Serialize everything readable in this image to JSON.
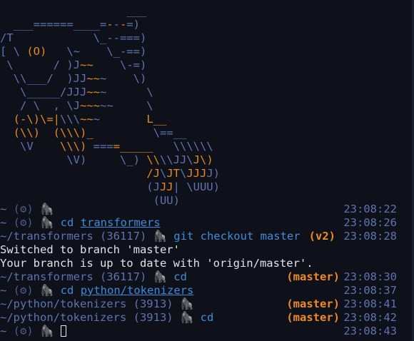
{
  "ascii_art": [
    [
      {
        "t": "                   ___"
      }
    ],
    [
      {
        "t": "  ___======____="
      },
      {
        "t": "-",
        "o": 1
      },
      {
        "t": "-"
      },
      {
        "t": "-",
        "o": 1
      },
      {
        "t": "=)"
      }
    ],
    [
      {
        "t": "/T            \\_--===)"
      }
    ],
    [
      {
        "t": "[ \\ "
      },
      {
        "t": "(O)",
        "o": 1
      },
      {
        "t": "   \\~    \\_-==)"
      }
    ],
    [
      {
        "t": " \\      / )J"
      },
      {
        "t": "~~",
        "o": 1
      },
      {
        "t": "    \\-=)"
      }
    ],
    [
      {
        "t": "  \\\\___/  )JJ"
      },
      {
        "t": "~~",
        "o": 1
      },
      {
        "t": "~    \\)"
      }
    ],
    [
      {
        "t": "   \\_____/JJJ"
      },
      {
        "t": "~~",
        "o": 1
      },
      {
        "t": "~      \\"
      }
    ],
    [
      {
        "t": "   / \\  , \\J"
      },
      {
        "t": "~~~",
        "o": 1
      },
      {
        "t": "~~     \\"
      }
    ],
    [
      {
        "t": "  "
      },
      {
        "t": "(-\\)\\=|",
        "o": 1
      },
      {
        "t": "\\\\\\"
      },
      {
        "t": "~~",
        "o": 1
      },
      {
        "t": "~       "
      },
      {
        "t": "L__",
        "o": 1
      }
    ],
    [
      {
        "t": "  "
      },
      {
        "t": "(\\\\)",
        "o": 1
      },
      {
        "t": "  "
      },
      {
        "t": "(\\\\\\)_",
        "o": 1
      },
      {
        "t": "         \\==__"
      }
    ],
    [
      {
        "t": "   \\V    "
      },
      {
        "t": "\\\\\\)",
        "o": 1
      },
      {
        "t": " ==="
      },
      {
        "t": "=_____",
        "o": 1
      },
      {
        "t": "   \\\\\\\\\\\\"
      }
    ],
    [
      {
        "t": "          \\V)     \\_) "
      },
      {
        "t": "\\\\",
        "o": 1
      },
      {
        "t": "\\\\JJ\\"
      },
      {
        "t": "J\\)",
        "o": 1
      }
    ],
    [
      {
        "t": "                      "
      },
      {
        "t": "/J",
        "o": 1
      },
      {
        "t": "\\"
      },
      {
        "t": "JT",
        "o": 1
      },
      {
        "t": "\\"
      },
      {
        "t": "JJJ",
        "o": 1
      },
      {
        "t": "J)"
      }
    ],
    [
      {
        "t": "                      (J"
      },
      {
        "t": "JJ",
        "o": 1
      },
      {
        "t": "| \\UUU)"
      }
    ],
    [
      {
        "t": "                       (UU)"
      }
    ]
  ],
  "terminal": {
    "lines": [
      {
        "parts": [
          {
            "t": "~ "
          },
          {
            "t": "(⚙)",
            "c": "dim"
          },
          {
            "t": " "
          },
          {
            "t": "🦍",
            "c": "bear"
          }
        ],
        "time": "23:08:22"
      },
      {
        "parts": [
          {
            "t": "~ "
          },
          {
            "t": "(⚙)",
            "c": "dim"
          },
          {
            "t": " "
          },
          {
            "t": "🦍",
            "c": "bear"
          },
          {
            "t": " "
          },
          {
            "t": "cd",
            "c": "cmd"
          },
          {
            "t": " "
          },
          {
            "t": "transformers",
            "c": "link"
          }
        ],
        "time": "23:08:26"
      },
      {
        "parts": [
          {
            "t": "~/transformers (36117) "
          },
          {
            "t": "🦍",
            "c": "bear"
          },
          {
            "t": " "
          },
          {
            "t": "git checkout master",
            "c": "cmd"
          }
        ],
        "tag": "(v2)",
        "tag_right": "110",
        "time": "23:08:28"
      },
      {
        "parts": [
          {
            "t": "Switched to branch 'master'",
            "c": "out"
          }
        ]
      },
      {
        "parts": [
          {
            "t": "Your branch is up to date with 'origin/master'.",
            "c": "out"
          }
        ]
      },
      {
        "parts": [
          {
            "t": "~/transformers (36117) "
          },
          {
            "t": "🦍",
            "c": "bear"
          },
          {
            "t": " "
          },
          {
            "t": "cd",
            "c": "cmd"
          }
        ],
        "tag": "(master)",
        "tag_right": "104",
        "time": "23:08:30"
      },
      {
        "parts": [
          {
            "t": "~ "
          },
          {
            "t": "(⚙)",
            "c": "dim"
          },
          {
            "t": " "
          },
          {
            "t": "🦍",
            "c": "bear"
          },
          {
            "t": " "
          },
          {
            "t": "cd",
            "c": "cmd"
          },
          {
            "t": " "
          },
          {
            "t": "python/tokenizers",
            "c": "link"
          }
        ],
        "time": "23:08:37"
      },
      {
        "parts": [
          {
            "t": "~/python/tokenizers (3913) "
          },
          {
            "t": "🦍",
            "c": "bear"
          }
        ],
        "tag": "(master)",
        "tag_right": "104",
        "time": "23:08:41"
      },
      {
        "parts": [
          {
            "t": "~/python/tokenizers (3913) "
          },
          {
            "t": "🦍",
            "c": "bear"
          },
          {
            "t": " "
          },
          {
            "t": "cd",
            "c": "cmd"
          }
        ],
        "tag": "(master)",
        "tag_right": "104",
        "time": "23:08:42"
      },
      {
        "parts": [
          {
            "t": "~ "
          },
          {
            "t": "(⚙)",
            "c": "dim"
          },
          {
            "t": " "
          },
          {
            "t": "🦍",
            "c": "bear"
          },
          {
            "t": " "
          }
        ],
        "cursor": true,
        "time": "23:08:43"
      }
    ]
  }
}
